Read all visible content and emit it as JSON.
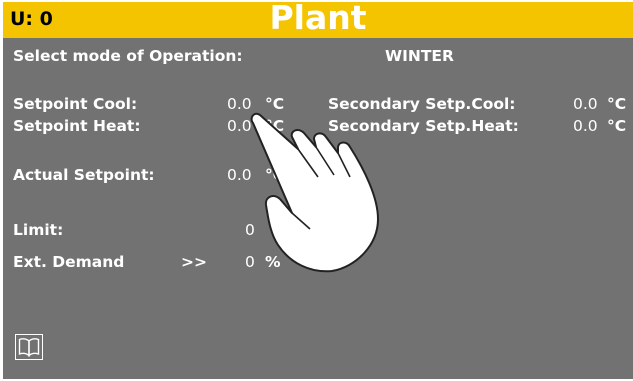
{
  "header": {
    "unit_label": "U: 0",
    "title": "Plant"
  },
  "mode": {
    "label": "Select mode of Operation:",
    "value": "WINTER"
  },
  "setpoint_cool": {
    "label": "Setpoint Cool:",
    "value": "0.0",
    "unit": "°C"
  },
  "setpoint_heat": {
    "label": "Setpoint Heat:",
    "value": "0.0",
    "unit": "°C"
  },
  "secondary_cool": {
    "label": "Secondary Setp.Cool:",
    "value": "0.0",
    "unit": "°C"
  },
  "secondary_heat": {
    "label": "Secondary Setp.Heat:",
    "value": "0.0",
    "unit": "°C"
  },
  "actual_setpoint": {
    "label": "Actual Setpoint:",
    "value": "0.0",
    "unit": "°C"
  },
  "limit": {
    "label": "Limit:",
    "value": "0"
  },
  "ext_demand": {
    "label": "Ext. Demand",
    "arrow": ">>",
    "value": "0",
    "unit": "%"
  },
  "icons": {
    "manual": "book-icon",
    "pointer": "hand-pointer-icon"
  },
  "colors": {
    "header": "#f5c400",
    "background": "#727272",
    "text": "#ffffff"
  }
}
